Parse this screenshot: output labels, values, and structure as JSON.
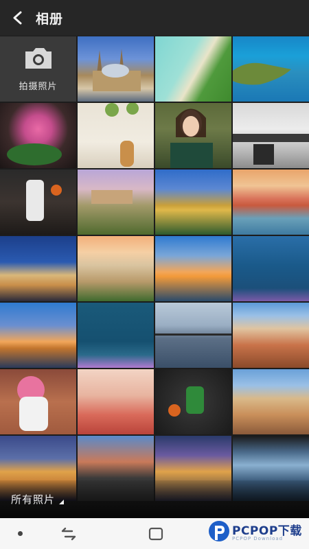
{
  "header": {
    "title": "相册",
    "back_icon": "back-arrow-icon"
  },
  "camera_tile": {
    "label": "拍摄照片",
    "icon": "camera-icon"
  },
  "photos": [
    {
      "desc": "cathedral"
    },
    {
      "desc": "beach-aerial"
    },
    {
      "desc": "island-coast"
    },
    {
      "desc": "pink-flowers"
    },
    {
      "desc": "vase-plant"
    },
    {
      "desc": "woman-portrait"
    },
    {
      "desc": "kitchen"
    },
    {
      "desc": "basketball"
    },
    {
      "desc": "hilltop-town"
    },
    {
      "desc": "castle-night"
    },
    {
      "desc": "harbor-town"
    },
    {
      "desc": "night-city"
    },
    {
      "desc": "palace"
    },
    {
      "desc": "skyline-river"
    },
    {
      "desc": "lake"
    },
    {
      "desc": "skyline-dusk"
    },
    {
      "desc": "lake-dark"
    },
    {
      "desc": "bridge"
    },
    {
      "desc": "city-roofs"
    },
    {
      "desc": "pitcher-flowers"
    },
    {
      "desc": "dining-room"
    },
    {
      "desc": "basketball-player"
    },
    {
      "desc": "old-city"
    },
    {
      "desc": "cathedral-night"
    },
    {
      "desc": "rock-arch"
    },
    {
      "desc": "tower-dusk"
    },
    {
      "desc": "lake-reflection"
    }
  ],
  "album_filter": {
    "label": "所有照片"
  },
  "system_nav": {
    "items": [
      "dot",
      "recent-apps",
      "home"
    ]
  },
  "watermark": {
    "brand": "PCPOP下载",
    "sub": "PCPOP Download"
  }
}
